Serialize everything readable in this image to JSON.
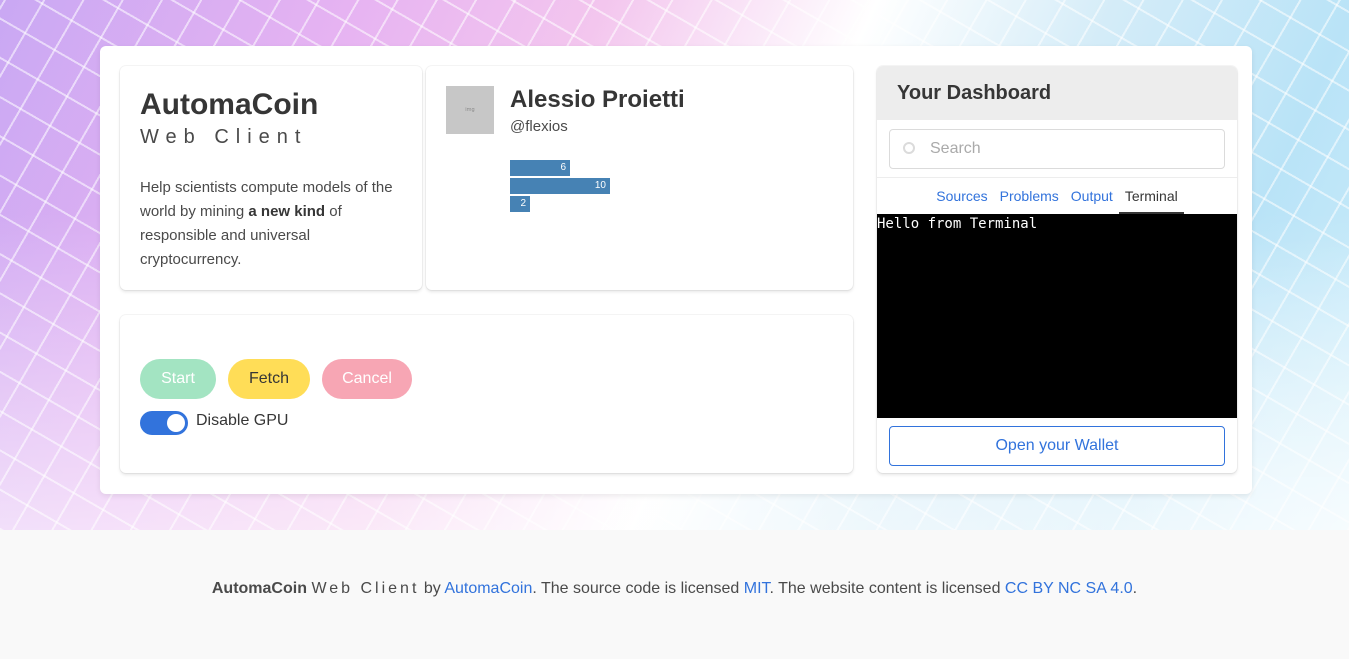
{
  "brand": {
    "title": "AutomaCoin",
    "subtitle": "Web Client",
    "desc_pre": "Help scientists compute models of the world by mining ",
    "desc_bold": "a new kind",
    "desc_post": " of responsible and universal cryptocurrency."
  },
  "user": {
    "avatar_text": "img",
    "name": "Alessio Proietti",
    "handle": "@flexios",
    "bar_color": "#4682b4"
  },
  "chart_data": {
    "type": "bar",
    "orientation": "horizontal",
    "categories": [
      "",
      "",
      ""
    ],
    "values": [
      6,
      10,
      2
    ],
    "xlim": [
      0,
      10
    ]
  },
  "controls": {
    "start_label": "Start",
    "fetch_label": "Fetch",
    "cancel_label": "Cancel",
    "gpu_toggle_label": "Disable GPU",
    "gpu_toggle_on": true
  },
  "dashboard": {
    "title": "Your Dashboard",
    "search_placeholder": "Search",
    "tabs": [
      {
        "label": "Sources",
        "active": false
      },
      {
        "label": "Problems",
        "active": false
      },
      {
        "label": "Output",
        "active": false
      },
      {
        "label": "Terminal",
        "active": true
      }
    ],
    "terminal_text": "Hello from Terminal",
    "wallet_label": "Open your Wallet"
  },
  "footer": {
    "brand": "AutomaCoin",
    "brand_sub": "Web Client",
    "by_text": " by ",
    "author_link": "AutomaCoin",
    "code_text": ". The source code is licensed ",
    "code_license": "MIT",
    "content_text": ". The website content is licensed ",
    "content_license": "CC BY NC SA 4.0",
    "end_text": "."
  },
  "colors": {
    "primary": "#3273dc",
    "success": "#a3e4c2",
    "warning": "#ffdd57",
    "danger": "#f7a6b4"
  }
}
